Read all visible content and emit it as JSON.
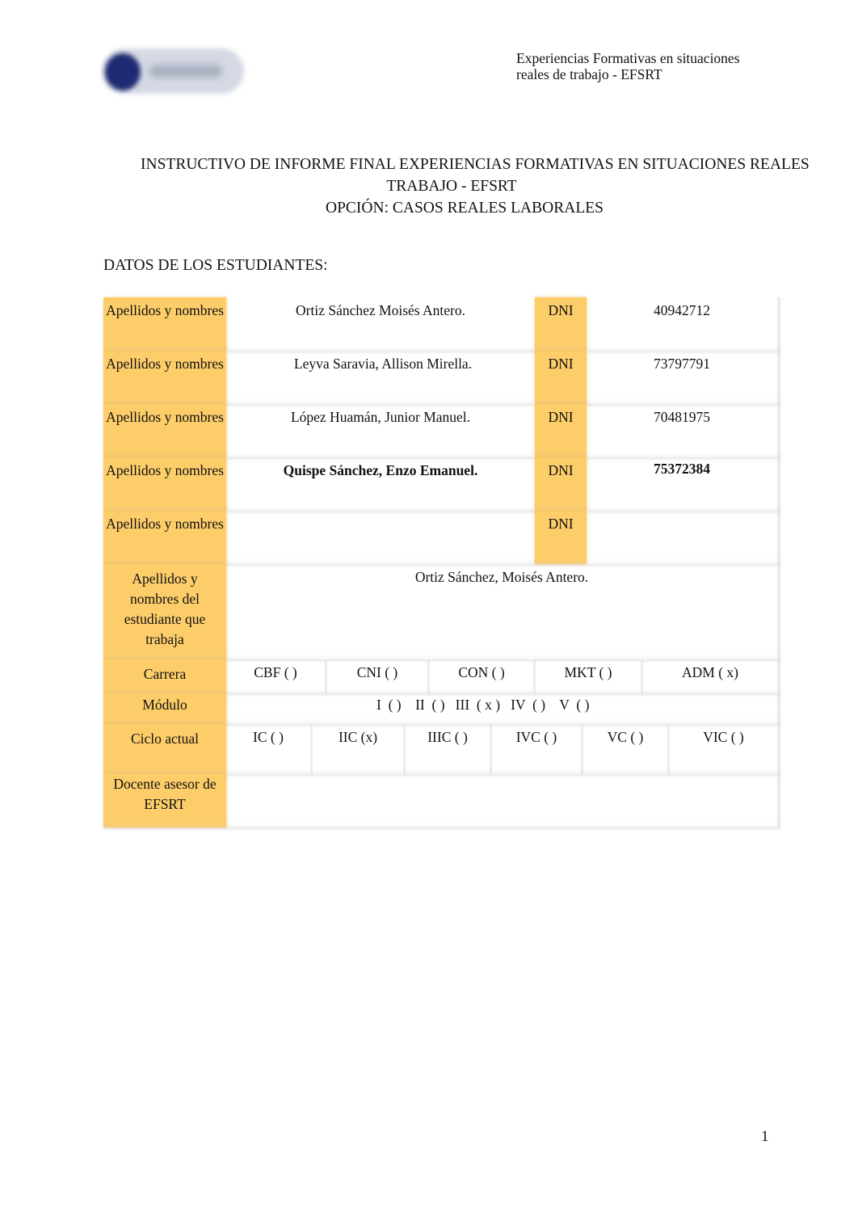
{
  "header": {
    "logo_icon": "institution-logo",
    "note_line1": "Experiencias Formativas en situaciones",
    "note_line2": "reales de trabajo - EFSRT"
  },
  "title": {
    "line1": "INSTRUCTIVO DE INFORME FINAL EXPERIENCIAS FORMATIVAS EN SITUACIONES REALES",
    "line2": "TRABAJO - EFSRT",
    "line3": "OPCIÓN: CASOS REALES LABORALES"
  },
  "section_heading": "DATOS DE LOS ESTUDIANTES:",
  "form": {
    "label_color": "#fdcd6a",
    "students": [
      {
        "label": "Apellidos y nombres",
        "name": "Ortiz Sánchez Moisés Antero.",
        "dni_label": "DNI",
        "dni": "40942712",
        "bold": false
      },
      {
        "label": "Apellidos y nombres",
        "name": "Leyva Saravia, Allison Mirella.",
        "dni_label": "DNI",
        "dni": "73797791",
        "bold": false
      },
      {
        "label": "Apellidos y nombres",
        "name": "López Huamán, Junior Manuel.",
        "dni_label": "DNI",
        "dni": "70481975",
        "bold": false
      },
      {
        "label": "Apellidos y nombres",
        "name": "Quispe Sánchez, Enzo Emanuel.",
        "dni_label": "DNI",
        "dni": "75372384",
        "bold": true
      },
      {
        "label": "Apellidos y nombres",
        "name": "",
        "dni_label": "DNI",
        "dni": "",
        "bold": false
      }
    ],
    "working_student": {
      "label": "Apellidos y nombres del estudiante que trabaja",
      "value": "Ortiz Sánchez, Moisés Antero."
    },
    "carrera": {
      "label": "Carrera",
      "options": [
        "CBF ( )",
        "CNI ( )",
        "CON ( )",
        "MKT  ( )",
        "ADM ( x)"
      ],
      "selected": "ADM"
    },
    "modulo": {
      "label": "Módulo",
      "value": "I  ( )    II  ( )   III  ( x )   IV  ( )    V  ( )",
      "selected": "III"
    },
    "ciclo": {
      "label": "Ciclo actual",
      "options": [
        "IC ( )",
        "IIC (x)",
        "IIIC ( )",
        "IVC ( )",
        "VC ( )",
        "VIC ( )"
      ],
      "selected": "IIC"
    },
    "docente": {
      "label": "Docente asesor de EFSRT",
      "value": ""
    }
  },
  "page_number": "1"
}
